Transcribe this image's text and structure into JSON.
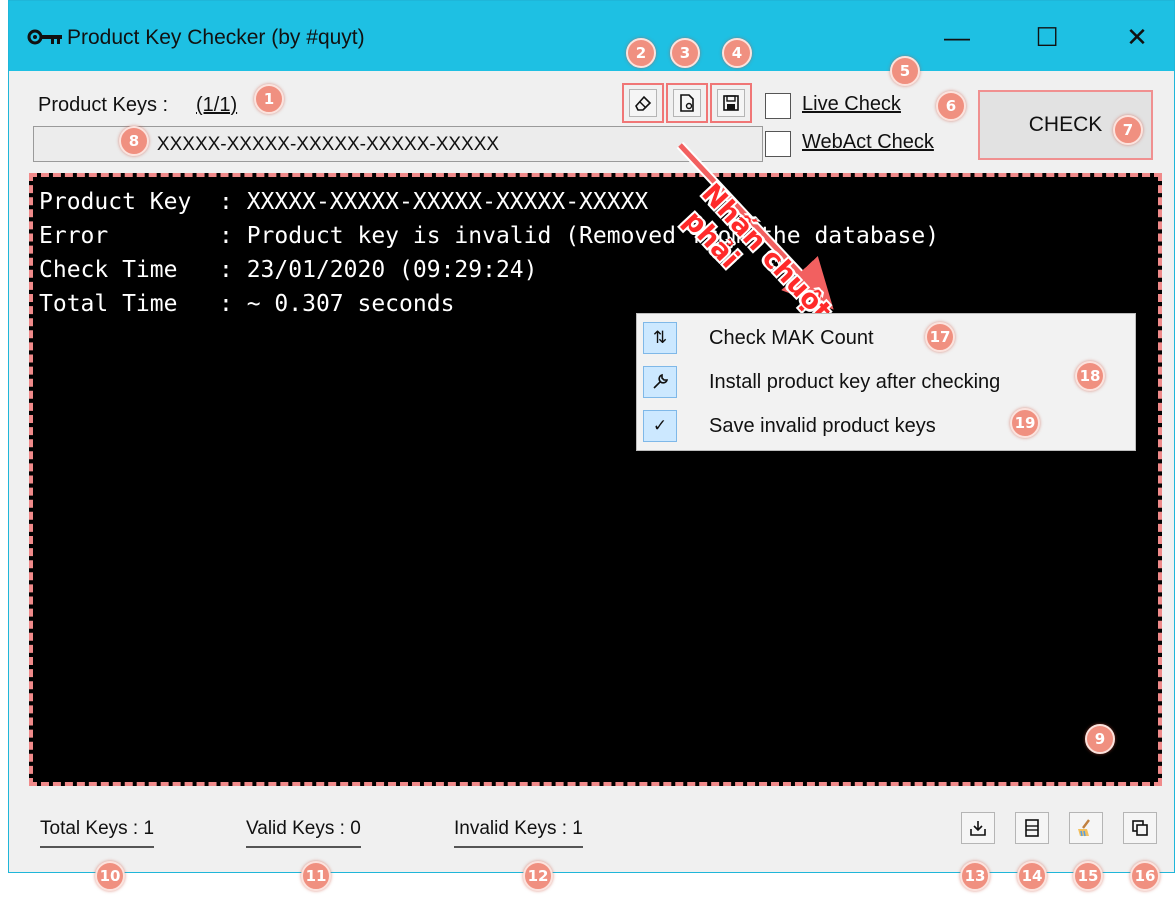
{
  "window": {
    "title": "Product Key Checker (by #quyt)",
    "minimize": "—",
    "maximize": "☐",
    "close": "✕"
  },
  "header": {
    "product_keys_label": "Product Keys :",
    "product_keys_count": "(1/1)",
    "key_input_value": "XXXXX-XXXXX-XXXXX-XXXXX-XXXXX",
    "toolbar_icons": [
      "eraser-icon",
      "file-open-icon",
      "save-icon"
    ],
    "live_check_label": "Live Check",
    "webact_check_label": "WebAct Check",
    "check_button_label": "CHECK"
  },
  "console": {
    "lines": [
      "Product Key  : XXXXX-XXXXX-XXXXX-XXXXX-XXXXX",
      "Error        : Product key is invalid (Removed from the database)",
      "Check Time   : 23/01/2020 (09:29:24)",
      "Total Time   : ~ 0.307 seconds"
    ]
  },
  "context_menu": {
    "items": [
      {
        "label": "Check MAK Count",
        "icon": "sort-arrows-icon",
        "glyph": "⇅"
      },
      {
        "label": "Install product key after checking",
        "icon": "wrench-icon",
        "glyph": "🔧"
      },
      {
        "label": "Save invalid product keys",
        "icon": "checkmark-icon",
        "glyph": "✓"
      }
    ]
  },
  "footer": {
    "total_keys": "Total Keys : 1",
    "valid_keys": "Valid Keys : 0",
    "invalid_keys": "Invalid Keys : 1",
    "buttons": [
      "export-icon",
      "list-icon",
      "clean-icon",
      "copy-icon"
    ]
  },
  "annotations": {
    "line1": "Nhấn chuột",
    "line2": "phải",
    "badges": [
      "1",
      "2",
      "3",
      "4",
      "5",
      "6",
      "7",
      "8",
      "9",
      "10",
      "11",
      "12",
      "13",
      "14",
      "15",
      "16",
      "17",
      "18",
      "19"
    ],
    "accent_color": "#f09080",
    "title_bar_color": "#1ec0e3"
  }
}
